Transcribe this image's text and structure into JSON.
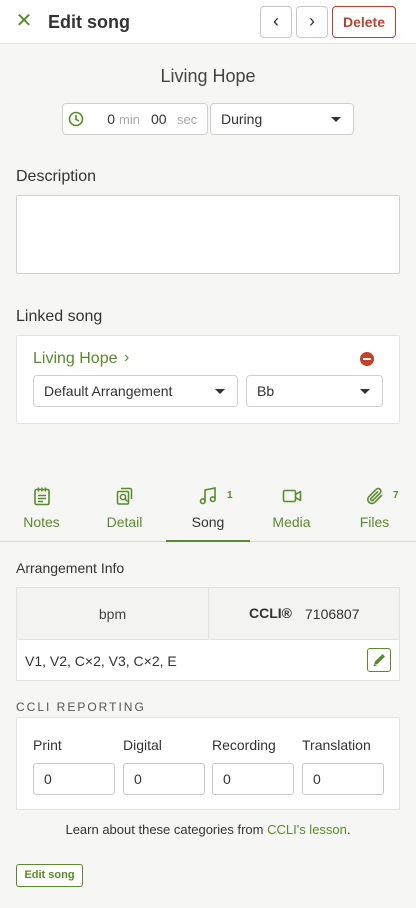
{
  "header": {
    "title": "Edit song",
    "close_icon": "close-icon",
    "prev_label": "‹",
    "next_label": "›",
    "delete_label": "Delete"
  },
  "song": {
    "title": "Living Hope",
    "duration": {
      "minutes": "0",
      "minutes_unit": "min",
      "seconds": "00",
      "seconds_unit": "sec"
    },
    "timing": "During"
  },
  "description": {
    "label": "Description",
    "value": ""
  },
  "linked_song": {
    "label": "Linked song",
    "name": "Living Hope",
    "chevron": "›",
    "arrangement": "Default Arrangement",
    "key": "Bb"
  },
  "tabs": [
    {
      "label": "Notes",
      "icon": "notes-icon",
      "count": ""
    },
    {
      "label": "Detail",
      "icon": "detail-search-icon",
      "count": ""
    },
    {
      "label": "Song",
      "icon": "music-note-icon",
      "count": "1",
      "active": true
    },
    {
      "label": "Media",
      "icon": "video-camera-icon",
      "count": ""
    },
    {
      "label": "Files",
      "icon": "paperclip-icon",
      "count": "7"
    }
  ],
  "arrangement_info": {
    "label": "Arrangement Info",
    "bpm_label": "bpm",
    "ccli_label": "CCLI®",
    "ccli_number": "7106807",
    "sequence": "V1, V2, C×2, V3, C×2, E"
  },
  "ccli_reporting": {
    "label": "CCLI REPORTING",
    "fields": [
      {
        "label": "Print",
        "value": "0"
      },
      {
        "label": "Digital",
        "value": "0"
      },
      {
        "label": "Recording",
        "value": "0"
      },
      {
        "label": "Translation",
        "value": "0"
      }
    ],
    "learn_prefix": "Learn about these categories from ",
    "learn_link": "CCLI's lesson",
    "learn_suffix": "."
  },
  "footer": {
    "edit_song_label": "Edit song"
  },
  "colors": {
    "accent": "#5a8a2e",
    "danger": "#b5442f",
    "background": "#f6f6f5"
  }
}
